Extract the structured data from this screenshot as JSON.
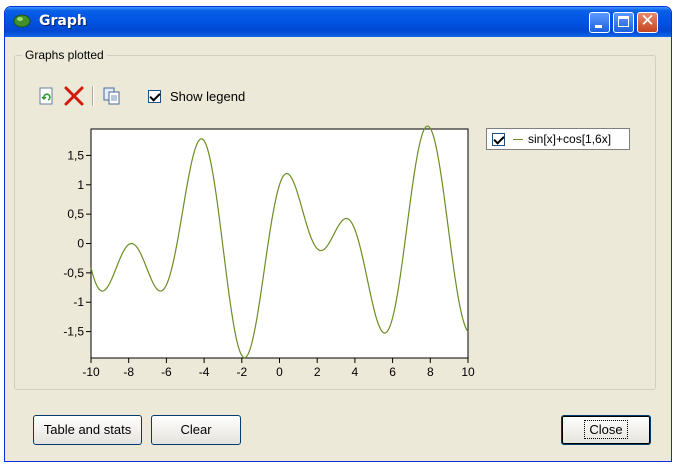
{
  "window": {
    "title": "Graph"
  },
  "group": {
    "label": "Graphs plotted"
  },
  "toolbar": {
    "show_legend_label": "Show legend",
    "show_legend_checked": true
  },
  "legend": {
    "entry": "sin[x]+cos[1,6x]",
    "checked": true,
    "series_color": "#6b8e23"
  },
  "buttons": {
    "table": "Table and stats",
    "clear": "Clear",
    "close": "Close"
  },
  "chart_data": {
    "type": "line",
    "function": "sin[x]+cos[1,6x]",
    "xlim": [
      -10,
      10
    ],
    "ylim": [
      -1.95,
      1.95
    ],
    "x_ticks": [
      "-10",
      "-8",
      "-6",
      "-4",
      "-2",
      "0",
      "2",
      "4",
      "6",
      "8",
      "10"
    ],
    "y_ticks": [
      "1,5",
      "1",
      "0,5",
      "0",
      "-0,5",
      "-1",
      "-1,5"
    ],
    "y_tick_values": [
      1.5,
      1,
      0.5,
      0,
      -0.5,
      -1,
      -1.5
    ],
    "x_tick_values": [
      -10,
      -8,
      -6,
      -4,
      -2,
      0,
      2,
      4,
      6,
      8,
      10
    ],
    "series": [
      {
        "name": "sin[x]+cos[1,6x]",
        "color": "#6b8e23",
        "samples": 400
      }
    ],
    "grid": false,
    "legend_position": "right"
  }
}
